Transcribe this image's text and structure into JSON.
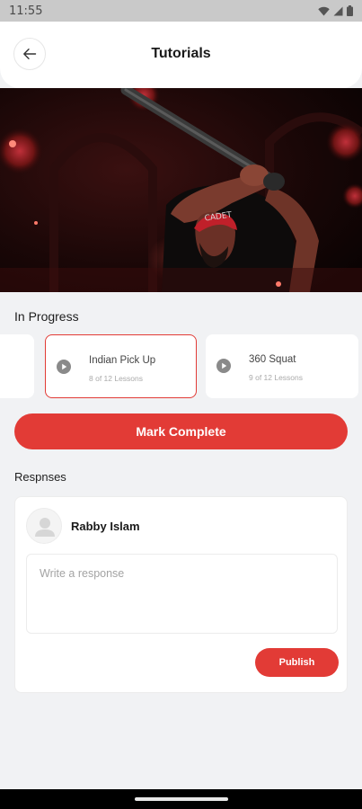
{
  "status_bar": {
    "time": "11:55",
    "icons": [
      "wifi-icon",
      "signal-icon",
      "battery-icon"
    ]
  },
  "header": {
    "title": "Tutorials",
    "back_icon": "arrow-left-icon"
  },
  "video": {
    "description_icon": "video-player"
  },
  "in_progress": {
    "title": "In Progress",
    "cards": [
      {
        "title": "",
        "subtitle": ""
      },
      {
        "title": "Indian Pick Up",
        "subtitle": "8 of 12 Lessons",
        "active": true
      },
      {
        "title": "360 Squat",
        "subtitle": "9 of 12 Lessons"
      }
    ]
  },
  "actions": {
    "mark_complete_label": "Mark Complete"
  },
  "responses": {
    "title": "Respnses",
    "user_name": "Rabby Islam",
    "input_placeholder": "Write a response",
    "publish_label": "Publish"
  },
  "colors": {
    "accent": "#e23b36",
    "background": "#f1f2f4",
    "card": "#ffffff"
  }
}
